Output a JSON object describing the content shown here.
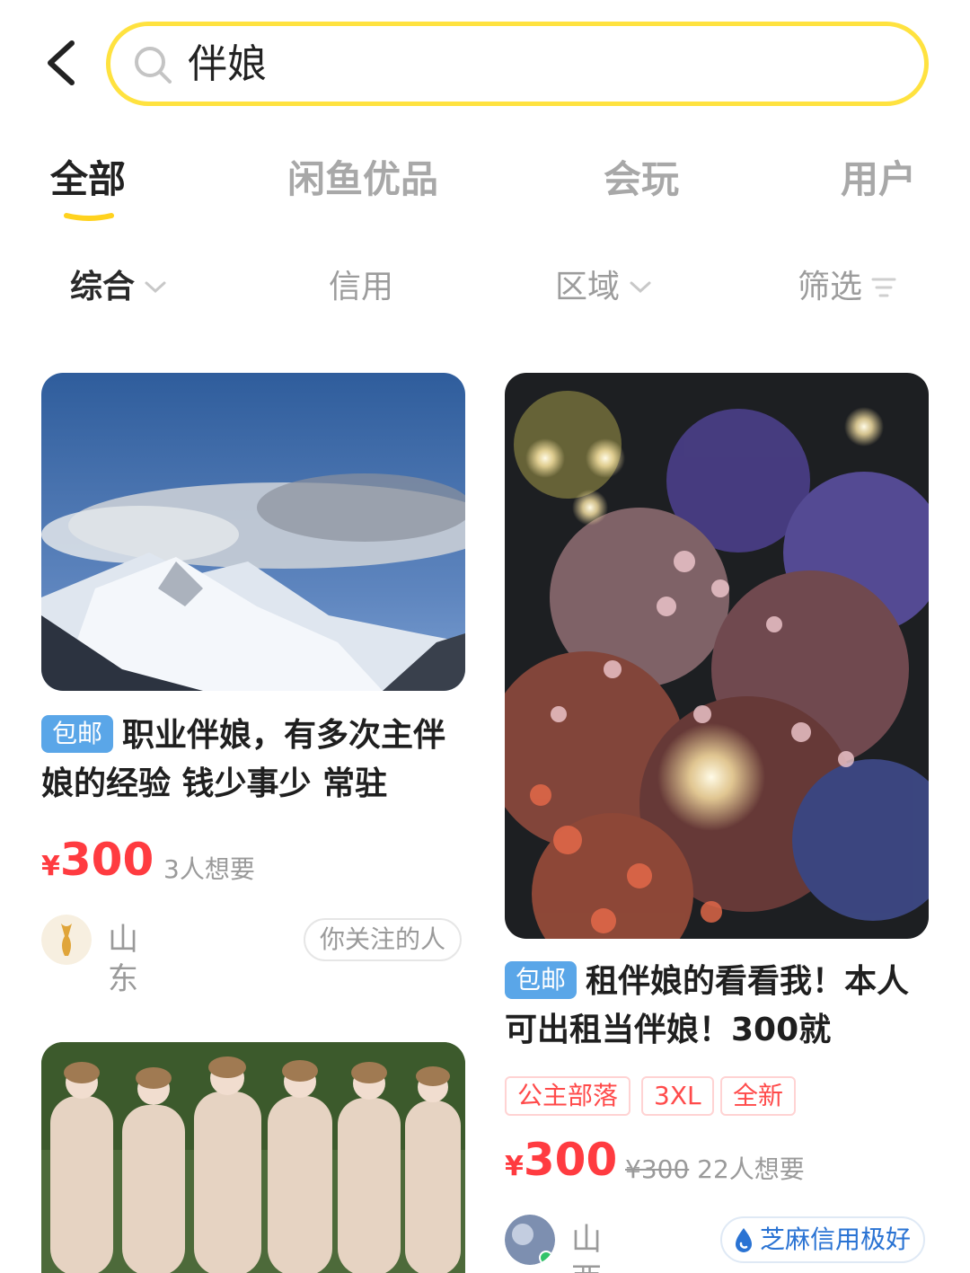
{
  "search": {
    "query": "伴娘"
  },
  "tabs": [
    {
      "label": "全部",
      "active": true
    },
    {
      "label": "闲鱼优品",
      "active": false
    },
    {
      "label": "会玩",
      "active": false
    },
    {
      "label": "用户",
      "active": false
    }
  ],
  "accent_color": "#ffe23f",
  "sort_options": [
    {
      "label": "综合",
      "active": true
    },
    {
      "label": "信用",
      "active": false
    },
    {
      "label": "区域",
      "active": false
    },
    {
      "label": "筛选",
      "active": false
    }
  ],
  "products": [
    {
      "badge": "包邮",
      "title": "职业伴娘，有多次主伴娘的经验 钱少事少 常驻",
      "currency": "¥",
      "price": "300",
      "wants": "3人想要",
      "location": "山东",
      "follow_label": "你关注的人",
      "image": "snowy-mountain-photo"
    },
    {
      "badge": "包邮",
      "title": "租伴娘的看看我！本人可出租当伴娘！300就",
      "tags": [
        "公主部落",
        "3XL",
        "全新"
      ],
      "currency": "¥",
      "price": "300",
      "original_price": "¥300",
      "wants": "22人想要",
      "location": "山西",
      "credit_label": "芝麻信用极好",
      "image": "flowers-fairy-lights-photo"
    },
    {
      "image": "bridesmaids-group-photo"
    }
  ],
  "price_color": "#ff3b40"
}
